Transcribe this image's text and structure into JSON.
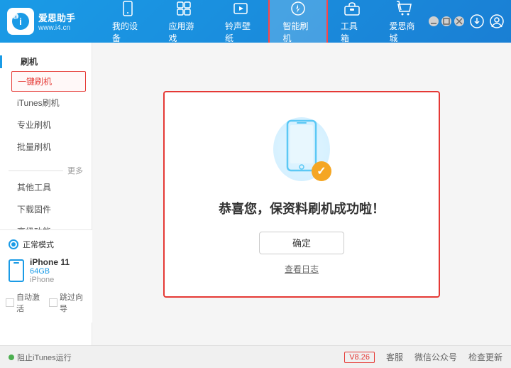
{
  "app": {
    "logo_line1": "爱思助手",
    "logo_line2": "www.i4.cn",
    "title": "爱思助手"
  },
  "header": {
    "nav": [
      {
        "id": "my-device",
        "label": "我的设备",
        "icon": "📱"
      },
      {
        "id": "apps",
        "label": "应用游戏",
        "icon": "🎮"
      },
      {
        "id": "ringtones",
        "label": "铃声壁纸",
        "icon": "🖼"
      },
      {
        "id": "smart-flash",
        "label": "智能刷机",
        "icon": "🔄",
        "active": true
      },
      {
        "id": "toolbox",
        "label": "工具箱",
        "icon": "🧰"
      },
      {
        "id": "store",
        "label": "爱思商城",
        "icon": "🛍"
      }
    ],
    "download_btn": "↓",
    "account_btn": "👤"
  },
  "window_controls": {
    "min": "—",
    "max": "□",
    "close": "✕"
  },
  "sidebar": {
    "section_flash": "刷机",
    "items": [
      {
        "label": "一键刷机",
        "active": true
      },
      {
        "label": "iTunes刷机",
        "active": false
      },
      {
        "label": "专业刷机",
        "active": false
      },
      {
        "label": "批量刷机",
        "active": false
      }
    ],
    "more_label": "更多",
    "more_items": [
      {
        "label": "其他工具"
      },
      {
        "label": "下载固件"
      },
      {
        "label": "高级功能"
      }
    ],
    "device_mode": "正常模式",
    "device_name": "iPhone 11",
    "device_storage": "64GB",
    "device_type": "iPhone",
    "checkbox1": "自动激活",
    "checkbox2": "跳过向导"
  },
  "footer": {
    "stop_itunes": "阻止iTunes运行",
    "version": "V8.26",
    "service": "客服",
    "wechat": "微信公众号",
    "check_update": "检查更新"
  },
  "success_card": {
    "title": "恭喜您，保资料刷机成功啦！",
    "confirm_btn": "确定",
    "history_link": "查看日志"
  }
}
